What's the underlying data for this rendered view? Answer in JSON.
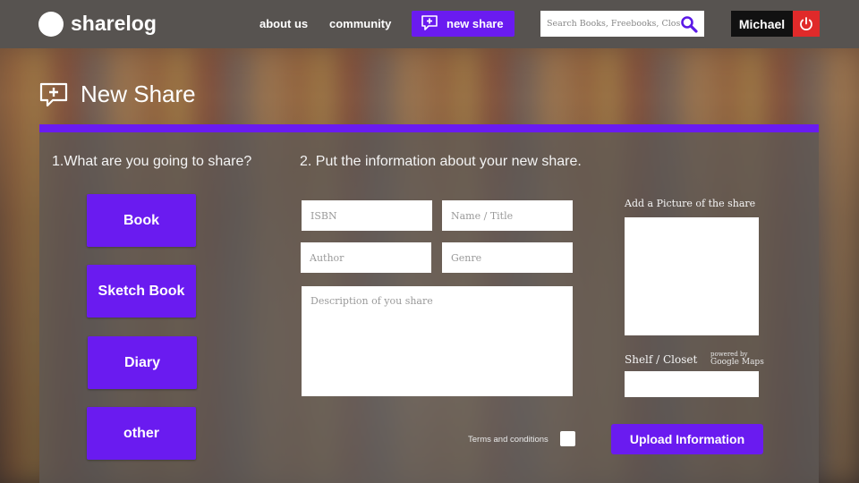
{
  "app": {
    "name": "sharelog"
  },
  "nav": {
    "about": "about us",
    "community": "community",
    "new_share": "new share"
  },
  "search": {
    "placeholder": "Search Books, Freebooks, Closets"
  },
  "user": {
    "name": "Michael"
  },
  "page": {
    "title": "New Share"
  },
  "steps": {
    "step1": "1.What are you going to share?",
    "step2": "2. Put the information about your  new share."
  },
  "share_types": [
    "Book",
    "Sketch Book",
    "Diary",
    "other"
  ],
  "form": {
    "isbn_placeholder": "ISBN",
    "title_placeholder": "Name / Title",
    "author_placeholder": "Author",
    "genre_placeholder": "Genre",
    "description_placeholder": "Description of you share",
    "picture_label": "Add a Picture of the share",
    "shelf_label": "Shelf / Closet",
    "powered_by": "powered by",
    "maps_brand": "Google Maps",
    "terms_label": "Terms and conditions",
    "upload_label": "Upload Information"
  },
  "icons": {
    "logo": "circle-logo-icon",
    "new_share": "add-comment-icon",
    "search": "search-icon",
    "power": "power-icon"
  },
  "colors": {
    "accent": "#6a1bf0",
    "topbar": "#575350",
    "power": "#e02a2a"
  }
}
